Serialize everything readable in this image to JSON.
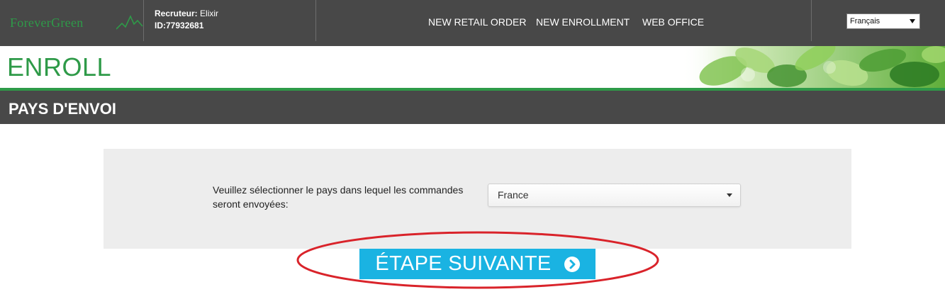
{
  "header": {
    "logo_text": "ForeverGreen",
    "recruiter_label": "Recruteur:",
    "recruiter_name": "Elixir",
    "id_label": "ID:",
    "id_value": "77932681",
    "nav": [
      {
        "label": "NEW RETAIL ORDER"
      },
      {
        "label": "NEW ENROLLMENT"
      },
      {
        "label": "WEB OFFICE"
      }
    ],
    "language": {
      "selected": "Français"
    }
  },
  "page": {
    "title": "ENROLL",
    "section_title": "PAYS D'ENVOI"
  },
  "form": {
    "prompt": "Veuillez sélectionner le pays dans lequel les commandes seront envoyées:",
    "country": {
      "selected": "France"
    }
  },
  "actions": {
    "next_label": "ÉTAPE SUIVANTE"
  },
  "colors": {
    "brand_green": "#2e9a48",
    "header_gray": "#484848",
    "button_blue": "#1ab3e2",
    "annotation_red": "#d9232a",
    "panel_gray": "#ededed"
  },
  "icons": {
    "next_button_icon": "chevron-right-circle-icon",
    "dropdown_icon": "caret-down-icon"
  }
}
